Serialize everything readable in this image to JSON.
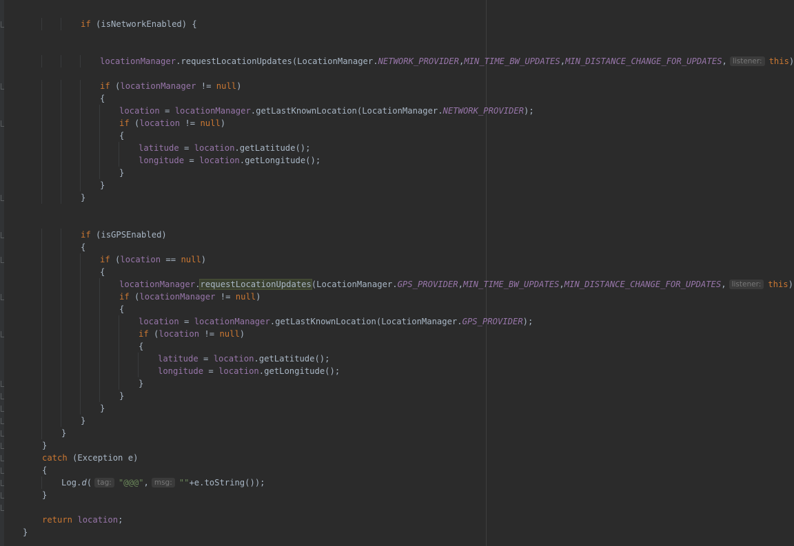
{
  "editor": {
    "lines": [
      {
        "indent": 3,
        "tokens": [
          {
            "t": "if",
            "c": "kw"
          },
          {
            "t": " (isNetworkEnabled) {"
          }
        ]
      },
      {
        "indent": 0,
        "tokens": []
      },
      {
        "indent": 0,
        "tokens": []
      },
      {
        "indent": 4,
        "tokens": [
          {
            "t": "locationManager",
            "c": "fld"
          },
          {
            "t": ".requestLocationUpdates(LocationManager."
          },
          {
            "t": "NETWORK_PROVIDER",
            "c": "cst"
          },
          {
            "t": ","
          },
          {
            "t": "MIN_TIME_BW_UPDATES",
            "c": "cst"
          },
          {
            "t": ","
          },
          {
            "t": "MIN_DISTANCE_CHANGE_FOR_UPDATES",
            "c": "cst"
          },
          {
            "t": ","
          },
          {
            "t": "listener:",
            "c": "hint"
          },
          {
            "t": "this",
            "c": "kw"
          },
          {
            "t": ");"
          }
        ]
      },
      {
        "indent": 0,
        "tokens": []
      },
      {
        "indent": 4,
        "tokens": [
          {
            "t": "if",
            "c": "kw"
          },
          {
            "t": " ("
          },
          {
            "t": "locationManager",
            "c": "fld"
          },
          {
            "t": " != "
          },
          {
            "t": "null",
            "c": "kw"
          },
          {
            "t": ")"
          }
        ]
      },
      {
        "indent": 4,
        "tokens": [
          {
            "t": "{"
          }
        ]
      },
      {
        "indent": 5,
        "tokens": [
          {
            "t": "location",
            "c": "fld"
          },
          {
            "t": " = "
          },
          {
            "t": "locationManager",
            "c": "fld"
          },
          {
            "t": ".getLastKnownLocation(LocationManager."
          },
          {
            "t": "NETWORK_PROVIDER",
            "c": "cst"
          },
          {
            "t": ");"
          }
        ]
      },
      {
        "indent": 5,
        "tokens": [
          {
            "t": "if",
            "c": "kw"
          },
          {
            "t": " ("
          },
          {
            "t": "location",
            "c": "fld"
          },
          {
            "t": " != "
          },
          {
            "t": "null",
            "c": "kw"
          },
          {
            "t": ")"
          }
        ]
      },
      {
        "indent": 5,
        "tokens": [
          {
            "t": "{"
          }
        ]
      },
      {
        "indent": 6,
        "tokens": [
          {
            "t": "latitude",
            "c": "fld"
          },
          {
            "t": " = "
          },
          {
            "t": "location",
            "c": "fld"
          },
          {
            "t": ".getLatitude();"
          }
        ]
      },
      {
        "indent": 6,
        "tokens": [
          {
            "t": "longitude",
            "c": "fld"
          },
          {
            "t": " = "
          },
          {
            "t": "location",
            "c": "fld"
          },
          {
            "t": ".getLongitude();"
          }
        ]
      },
      {
        "indent": 5,
        "tokens": [
          {
            "t": "}"
          }
        ]
      },
      {
        "indent": 4,
        "tokens": [
          {
            "t": "}"
          }
        ]
      },
      {
        "indent": 3,
        "tokens": [
          {
            "t": "}"
          }
        ]
      },
      {
        "indent": 0,
        "tokens": []
      },
      {
        "indent": 0,
        "tokens": []
      },
      {
        "indent": 3,
        "tokens": [
          {
            "t": "if",
            "c": "kw"
          },
          {
            "t": " (isGPSEnabled)"
          }
        ]
      },
      {
        "indent": 3,
        "tokens": [
          {
            "t": "{"
          }
        ]
      },
      {
        "indent": 4,
        "tokens": [
          {
            "t": "if",
            "c": "kw"
          },
          {
            "t": " ("
          },
          {
            "t": "location",
            "c": "fld"
          },
          {
            "t": " == "
          },
          {
            "t": "null",
            "c": "kw"
          },
          {
            "t": ")"
          }
        ]
      },
      {
        "indent": 4,
        "tokens": [
          {
            "t": "{"
          }
        ]
      },
      {
        "indent": 5,
        "tokens": [
          {
            "t": "locationManager",
            "c": "fld"
          },
          {
            "t": "."
          },
          {
            "t": "requestLocationUpdates",
            "c": "hl"
          },
          {
            "t": "(LocationManager."
          },
          {
            "t": "GPS_PROVIDER",
            "c": "cst"
          },
          {
            "t": ","
          },
          {
            "t": "MIN_TIME_BW_UPDATES",
            "c": "cst"
          },
          {
            "t": ","
          },
          {
            "t": "MIN_DISTANCE_CHANGE_FOR_UPDATES",
            "c": "cst"
          },
          {
            "t": ","
          },
          {
            "t": "listener:",
            "c": "hint"
          },
          {
            "t": "this",
            "c": "kw"
          },
          {
            "t": ");"
          }
        ]
      },
      {
        "indent": 5,
        "tokens": [
          {
            "t": "if",
            "c": "kw"
          },
          {
            "t": " ("
          },
          {
            "t": "locationManager",
            "c": "fld"
          },
          {
            "t": " != "
          },
          {
            "t": "null",
            "c": "kw"
          },
          {
            "t": ")"
          }
        ]
      },
      {
        "indent": 5,
        "tokens": [
          {
            "t": "{"
          }
        ]
      },
      {
        "indent": 6,
        "tokens": [
          {
            "t": "location",
            "c": "fld"
          },
          {
            "t": " = "
          },
          {
            "t": "locationManager",
            "c": "fld"
          },
          {
            "t": ".getLastKnownLocation(LocationManager."
          },
          {
            "t": "GPS_PROVIDER",
            "c": "cst"
          },
          {
            "t": ");"
          }
        ]
      },
      {
        "indent": 6,
        "tokens": [
          {
            "t": "if",
            "c": "kw"
          },
          {
            "t": " ("
          },
          {
            "t": "location",
            "c": "fld"
          },
          {
            "t": " != "
          },
          {
            "t": "null",
            "c": "kw"
          },
          {
            "t": ")"
          }
        ]
      },
      {
        "indent": 6,
        "tokens": [
          {
            "t": "{"
          }
        ]
      },
      {
        "indent": 7,
        "tokens": [
          {
            "t": "latitude",
            "c": "fld"
          },
          {
            "t": " = "
          },
          {
            "t": "location",
            "c": "fld"
          },
          {
            "t": ".getLatitude();"
          }
        ]
      },
      {
        "indent": 7,
        "tokens": [
          {
            "t": "longitude",
            "c": "fld"
          },
          {
            "t": " = "
          },
          {
            "t": "location",
            "c": "fld"
          },
          {
            "t": ".getLongitude();"
          }
        ]
      },
      {
        "indent": 6,
        "tokens": [
          {
            "t": "}"
          }
        ]
      },
      {
        "indent": 5,
        "tokens": [
          {
            "t": "}"
          }
        ]
      },
      {
        "indent": 4,
        "tokens": [
          {
            "t": "}"
          }
        ]
      },
      {
        "indent": 3,
        "tokens": [
          {
            "t": "}"
          }
        ]
      },
      {
        "indent": 2,
        "tokens": [
          {
            "t": "}"
          }
        ]
      },
      {
        "indent": 1,
        "tokens": [
          {
            "t": "}"
          }
        ]
      },
      {
        "indent": 1,
        "tokens": [
          {
            "t": "catch",
            "c": "kw"
          },
          {
            "t": " (Exception e)"
          }
        ]
      },
      {
        "indent": 1,
        "tokens": [
          {
            "t": "{"
          }
        ]
      },
      {
        "indent": 2,
        "tokens": [
          {
            "t": "Log."
          },
          {
            "t": "d",
            "c": "it"
          },
          {
            "t": "("
          },
          {
            "t": "tag:",
            "c": "hint"
          },
          {
            "t": "\"@@@\"",
            "c": "str"
          },
          {
            "t": ","
          },
          {
            "t": "msg:",
            "c": "hint"
          },
          {
            "t": "\"\"",
            "c": "str"
          },
          {
            "t": "+e.toString());"
          }
        ]
      },
      {
        "indent": 1,
        "tokens": [
          {
            "t": "}"
          }
        ]
      },
      {
        "indent": 0,
        "tokens": []
      },
      {
        "indent": 1,
        "tokens": [
          {
            "t": "return",
            "c": "kw"
          },
          {
            "t": " "
          },
          {
            "t": "location",
            "c": "fld"
          },
          {
            "t": ";"
          }
        ]
      },
      {
        "indent": 0,
        "tokens": [
          {
            "t": "}"
          }
        ]
      }
    ],
    "folds": [
      0,
      5,
      8,
      14,
      17,
      19,
      22,
      25,
      29,
      30,
      31,
      32,
      33,
      34,
      35,
      36,
      37,
      38,
      39,
      42
    ]
  }
}
